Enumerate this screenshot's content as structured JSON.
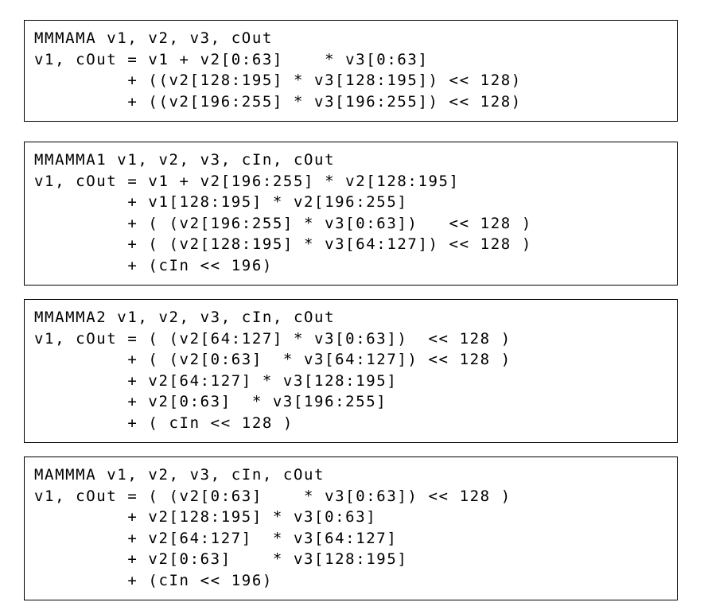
{
  "blocks": [
    {
      "lines": [
        "MMMAMA v1, v2, v3, cOut",
        "v1, cOut = v1 + v2[0:63]    * v3[0:63]",
        "         + ((v2[128:195] * v3[128:195]) << 128)",
        "         + ((v2[196:255] * v3[196:255]) << 128)"
      ]
    },
    {
      "lines": [
        "MMAMMA1 v1, v2, v3, cIn, cOut",
        "v1, cOut = v1 + v2[196:255] * v2[128:195]",
        "         + v1[128:195] * v2[196:255]",
        "         + ( (v2[196:255] * v3[0:63])   << 128 )",
        "         + ( (v2[128:195] * v3[64:127]) << 128 )",
        "         + (cIn << 196)"
      ]
    },
    {
      "lines": [
        "MMAMMA2 v1, v2, v3, cIn, cOut",
        "v1, cOut = ( (v2[64:127] * v3[0:63])  << 128 )",
        "         + ( (v2[0:63]  * v3[64:127]) << 128 )",
        "         + v2[64:127] * v3[128:195]",
        "         + v2[0:63]  * v3[196:255]",
        "         + ( cIn << 128 )"
      ]
    },
    {
      "lines": [
        "MAMMMA v1, v2, v3, cIn, cOut",
        "v1, cOut = ( (v2[0:63]    * v3[0:63]) << 128 )",
        "         + v2[128:195] * v3[0:63]",
        "         + v2[64:127]  * v3[64:127]",
        "         + v2[0:63]    * v3[128:195]",
        "         + (cIn << 196)"
      ]
    }
  ]
}
